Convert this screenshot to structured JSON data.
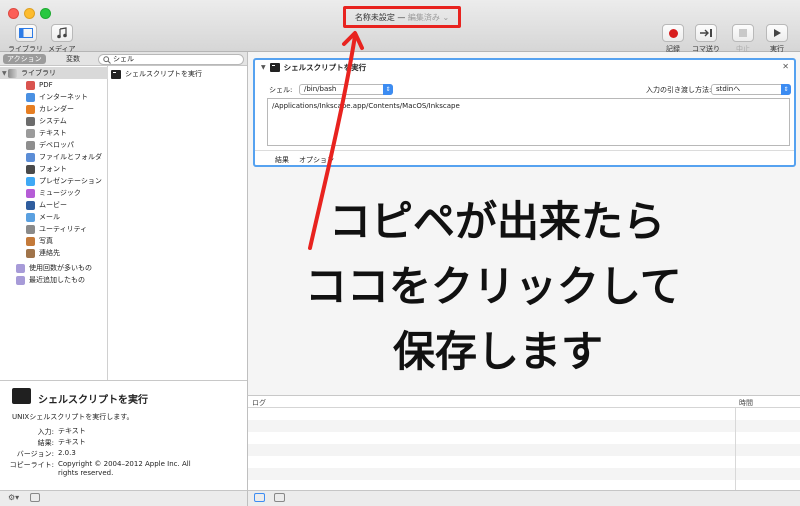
{
  "window": {
    "title": "名称未設定",
    "title_separator": "—",
    "title_status": "編集済み",
    "accent_color": "#3c8cf2",
    "annotation_border_color": "#e8231f"
  },
  "toolbar": {
    "library_label": "ライブラリ",
    "media_label": "メディア",
    "record_label": "記録",
    "step_label": "コマ送り",
    "stop_label": "中止",
    "run_label": "実行"
  },
  "library": {
    "actions_tab": "アクション",
    "variables_tab": "変数",
    "search_value": "シェル",
    "root_label": "ライブラリ",
    "categories": [
      "PDF",
      "インターネット",
      "カレンダー",
      "システム",
      "テキスト",
      "デベロッパ",
      "ファイルとフォルダ",
      "フォント",
      "プレゼンテーション",
      "ミュージック",
      "ムービー",
      "メール",
      "ユーティリティ",
      "写真",
      "連絡先"
    ],
    "smart_folders": [
      "使用回数が多いもの",
      "最近追加したもの"
    ],
    "action_results": [
      "シェルスクリプトを実行"
    ]
  },
  "description": {
    "title": "シェルスクリプトを実行",
    "summary": "UNIXシェルスクリプトを実行します。",
    "input_key": "入力:",
    "input_value": "テキスト",
    "result_key": "結果:",
    "result_value": "テキスト",
    "version_key": "バージョン:",
    "version_value": "2.0.3",
    "copyright_key": "コピーライト:",
    "copyright_value": "Copyright © 2004–2012 Apple Inc.  All rights reserved."
  },
  "action_card": {
    "title": "シェルスクリプトを実行",
    "shell_label": "シェル:",
    "shell_value": "/bin/bash",
    "input_method_label": "入力の引き渡し方法:",
    "input_method_value": "stdinへ",
    "script": "/Applications/Inkscape.app/Contents/MacOS/Inkscape",
    "tab_results": "結果",
    "tab_options": "オプション"
  },
  "annotation": {
    "line1": "コピペが出来たら",
    "line2": "ココをクリックして",
    "line3": "保存します"
  },
  "log": {
    "col_log": "ログ",
    "col_time": "時間"
  }
}
